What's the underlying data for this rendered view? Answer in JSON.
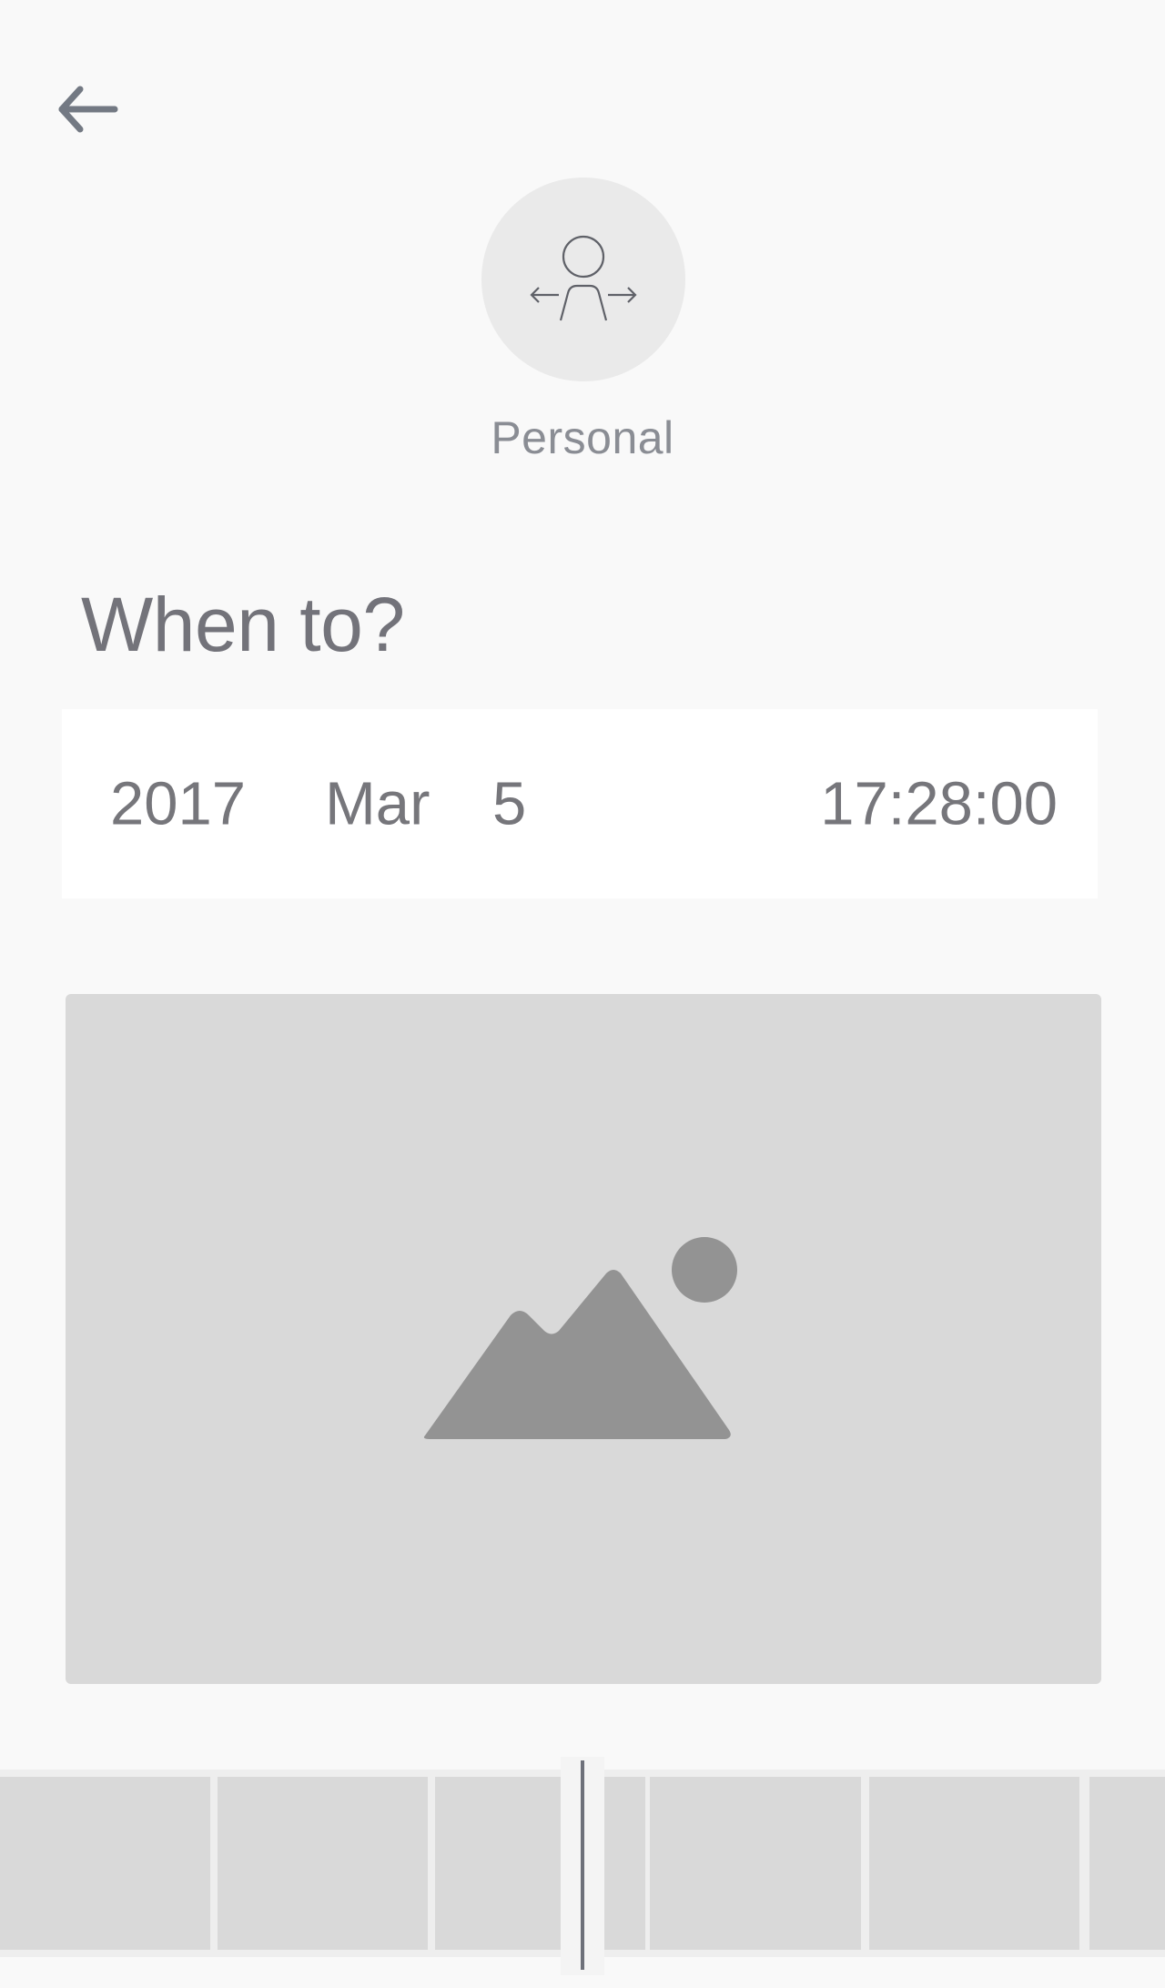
{
  "header": {
    "back_icon": "arrow-left-icon"
  },
  "profile": {
    "icon": "person-arrows-icon",
    "label": "Personal"
  },
  "schedule": {
    "title": "When to?",
    "year": "2017",
    "month": "Mar",
    "day": "5",
    "time": "17:28:00"
  },
  "preview": {
    "icon": "image-placeholder-icon"
  },
  "timeline": {
    "thumbnail_count": 6
  },
  "colors": {
    "background": "#f9f9f9",
    "placeholder": "#d9d9d9",
    "text": "#77777c",
    "icon": "#6e717a"
  }
}
